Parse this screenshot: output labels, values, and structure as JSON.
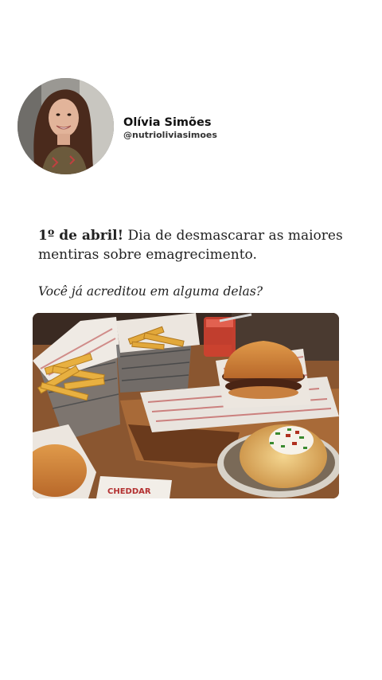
{
  "profile": {
    "display_name": "Olívia Simões",
    "handle": "@nutrioliviasimoes"
  },
  "post": {
    "lead_bold": "1º de abril!",
    "lead_rest": " Dia de desmascarar as maiores mentiras sobre emagrecimento.",
    "question": "Você já acreditou em alguma delas?"
  },
  "photo": {
    "paper_print_text": "CHEDDAR"
  },
  "colors": {
    "background": "#ffffff",
    "text": "#222222"
  }
}
